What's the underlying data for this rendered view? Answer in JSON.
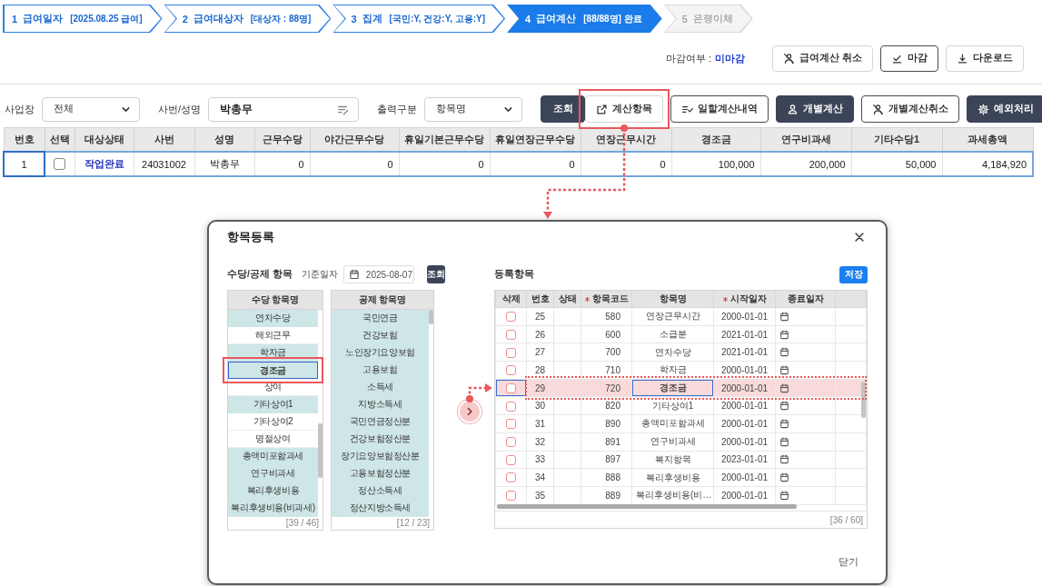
{
  "steps": [
    {
      "number": "1",
      "label": "급여일자",
      "detail": "[2025.08.25 급여]",
      "completed": true,
      "selected": false
    },
    {
      "number": "2",
      "label": "급여대상자",
      "detail": "[대상자 : 88명]",
      "completed": true,
      "selected": false
    },
    {
      "number": "3",
      "label": "집계",
      "detail": "[국민:Y, 건강:Y, 고용:Y]",
      "completed": true,
      "selected": false
    },
    {
      "number": "4",
      "label": "급여계산",
      "detail": "[88/88명] 완료",
      "completed": false,
      "selected": true
    },
    {
      "number": "5",
      "label": "은행이체",
      "completed": false,
      "selected": false
    }
  ],
  "closing": {
    "label": "마감여부 :",
    "value": "미마감"
  },
  "top_actions": [
    {
      "label": "급여계산 취소",
      "kind": "plain"
    },
    {
      "label": "마감",
      "kind": "outline"
    },
    {
      "label": "다운로드",
      "kind": "plain"
    }
  ],
  "filters": [
    {
      "label": "사업장",
      "kind": "select",
      "value": "전체"
    },
    {
      "label": "사번/성명",
      "kind": "text",
      "value": "박총무"
    },
    {
      "label": "출력구분",
      "kind": "select",
      "value": "항목명"
    }
  ],
  "search_button": "조회",
  "actions": [
    {
      "label": "계산항목",
      "kind": "plain"
    },
    {
      "label": "일할계산내역",
      "kind": "outline"
    },
    {
      "label": "개별계산",
      "kind": "dark"
    },
    {
      "label": "개별계산취소",
      "kind": "outline"
    },
    {
      "label": "예외처리",
      "kind": "dark"
    }
  ],
  "table": {
    "columns": [
      {
        "label": "번호",
        "kind": "text"
      },
      {
        "label": "선택",
        "kind": "checkbox"
      },
      {
        "label": "대상상태",
        "kind": "link"
      },
      {
        "label": "사번",
        "kind": "text"
      },
      {
        "label": "성명",
        "kind": "text"
      },
      {
        "label": "근무수당",
        "kind": "number"
      },
      {
        "label": "야간근무수당",
        "kind": "number"
      },
      {
        "label": "휴일기본근무수당",
        "kind": "number"
      },
      {
        "label": "휴일연장근무수당",
        "kind": "number"
      },
      {
        "label": "연장근무시간",
        "kind": "number"
      },
      {
        "label": "경조금",
        "kind": "number"
      },
      {
        "label": "연구비과세",
        "kind": "number"
      },
      {
        "label": "기타수당1",
        "kind": "number"
      },
      {
        "label": "과세총액",
        "kind": "number"
      }
    ],
    "rows": [
      {
        "selected": true,
        "checked": false,
        "cells": [
          "1",
          "",
          "작업완료",
          "24031002",
          "박총무",
          "0",
          "0",
          "0",
          "0",
          "0",
          "100,000",
          "200,000",
          "50,000",
          "4,184,920"
        ]
      }
    ]
  },
  "modal": {
    "title": "항목등록",
    "section_label": "수당/공제 항목",
    "date_label": "기준일자",
    "date_value": "2025-08-07",
    "search_button": "조회",
    "allowance_list": {
      "header": "수당 항목명",
      "count": "[39 / 46]",
      "items": [
        {
          "label": "연차수당",
          "registered": true,
          "selected": false
        },
        {
          "label": "해외근무",
          "registered": false,
          "selected": false
        },
        {
          "label": "학자금",
          "registered": true,
          "selected": false
        },
        {
          "label": "경조금",
          "registered": true,
          "selected": true
        },
        {
          "label": "상여",
          "registered": false,
          "selected": false
        },
        {
          "label": "기타상여1",
          "registered": true,
          "selected": false
        },
        {
          "label": "기타상여2",
          "registered": false,
          "selected": false
        },
        {
          "label": "명절상여",
          "registered": false,
          "selected": false
        },
        {
          "label": "총액미포함과세",
          "registered": true,
          "selected": false
        },
        {
          "label": "연구비과세",
          "registered": true,
          "selected": false
        },
        {
          "label": "복리후생비용",
          "registered": true,
          "selected": false
        },
        {
          "label": "복리후생비용(비과세)",
          "registered": true,
          "selected": false
        }
      ]
    },
    "deduction_list": {
      "header": "공제 항목명",
      "count": "[12 / 23]",
      "items": [
        {
          "label": "국민연금",
          "registered": true,
          "selected": false
        },
        {
          "label": "건강보험",
          "registered": true,
          "selected": false
        },
        {
          "label": "노인장기요양보험",
          "registered": true,
          "selected": false
        },
        {
          "label": "고용보험",
          "registered": true,
          "selected": false
        },
        {
          "label": "소득세",
          "registered": true,
          "selected": false
        },
        {
          "label": "지방소득세",
          "registered": true,
          "selected": false
        },
        {
          "label": "국민연금정산분",
          "registered": true,
          "selected": false
        },
        {
          "label": "건강보험정산분",
          "registered": true,
          "selected": false
        },
        {
          "label": "장기요양보험정산분",
          "registered": true,
          "selected": false
        },
        {
          "label": "고용보험정산분",
          "registered": true,
          "selected": false
        },
        {
          "label": "정산소득세",
          "registered": true,
          "selected": false
        },
        {
          "label": "정산지방소득세",
          "registered": true,
          "selected": false
        }
      ]
    },
    "registered": {
      "label": "등록항목",
      "save_button": "저장",
      "count": "[36 / 60]",
      "columns": [
        {
          "label": "삭제",
          "required": false
        },
        {
          "label": "번호",
          "required": false
        },
        {
          "label": "상태",
          "required": false
        },
        {
          "label": "항목코드",
          "required": true
        },
        {
          "label": "항목명",
          "required": false
        },
        {
          "label": "시작일자",
          "required": true
        },
        {
          "label": "종료일자",
          "required": false
        }
      ],
      "rows": [
        {
          "number": "25",
          "code": "580",
          "name": "연장근무시간",
          "start_date": "2000-01-01",
          "checked": false,
          "selected": false
        },
        {
          "number": "26",
          "code": "600",
          "name": "소급분",
          "start_date": "2021-01-01",
          "checked": false,
          "selected": false
        },
        {
          "number": "27",
          "code": "700",
          "name": "연차수당",
          "start_date": "2021-01-01",
          "checked": false,
          "selected": false
        },
        {
          "number": "28",
          "code": "710",
          "name": "학자금",
          "start_date": "2000-01-01",
          "checked": false,
          "selected": false
        },
        {
          "number": "29",
          "code": "720",
          "name": "경조금",
          "start_date": "2000-01-01",
          "checked": false,
          "selected": true
        },
        {
          "number": "30",
          "code": "820",
          "name": "기타상여1",
          "start_date": "2000-01-01",
          "checked": false,
          "selected": false
        },
        {
          "number": "31",
          "code": "890",
          "name": "총액미포함과세",
          "start_date": "2000-01-01",
          "checked": false,
          "selected": false
        },
        {
          "number": "32",
          "code": "891",
          "name": "연구비과세",
          "start_date": "2000-01-01",
          "checked": false,
          "selected": false
        },
        {
          "number": "33",
          "code": "897",
          "name": "복지항목",
          "start_date": "2023-01-01",
          "checked": false,
          "selected": false
        },
        {
          "number": "34",
          "code": "888",
          "name": "복리후생비용",
          "start_date": "2000-01-01",
          "checked": false,
          "selected": false
        },
        {
          "number": "35",
          "code": "889",
          "name": "복리후생비용(비…",
          "start_date": "2000-01-01",
          "checked": false,
          "selected": false
        }
      ]
    },
    "close_button": "닫기"
  }
}
